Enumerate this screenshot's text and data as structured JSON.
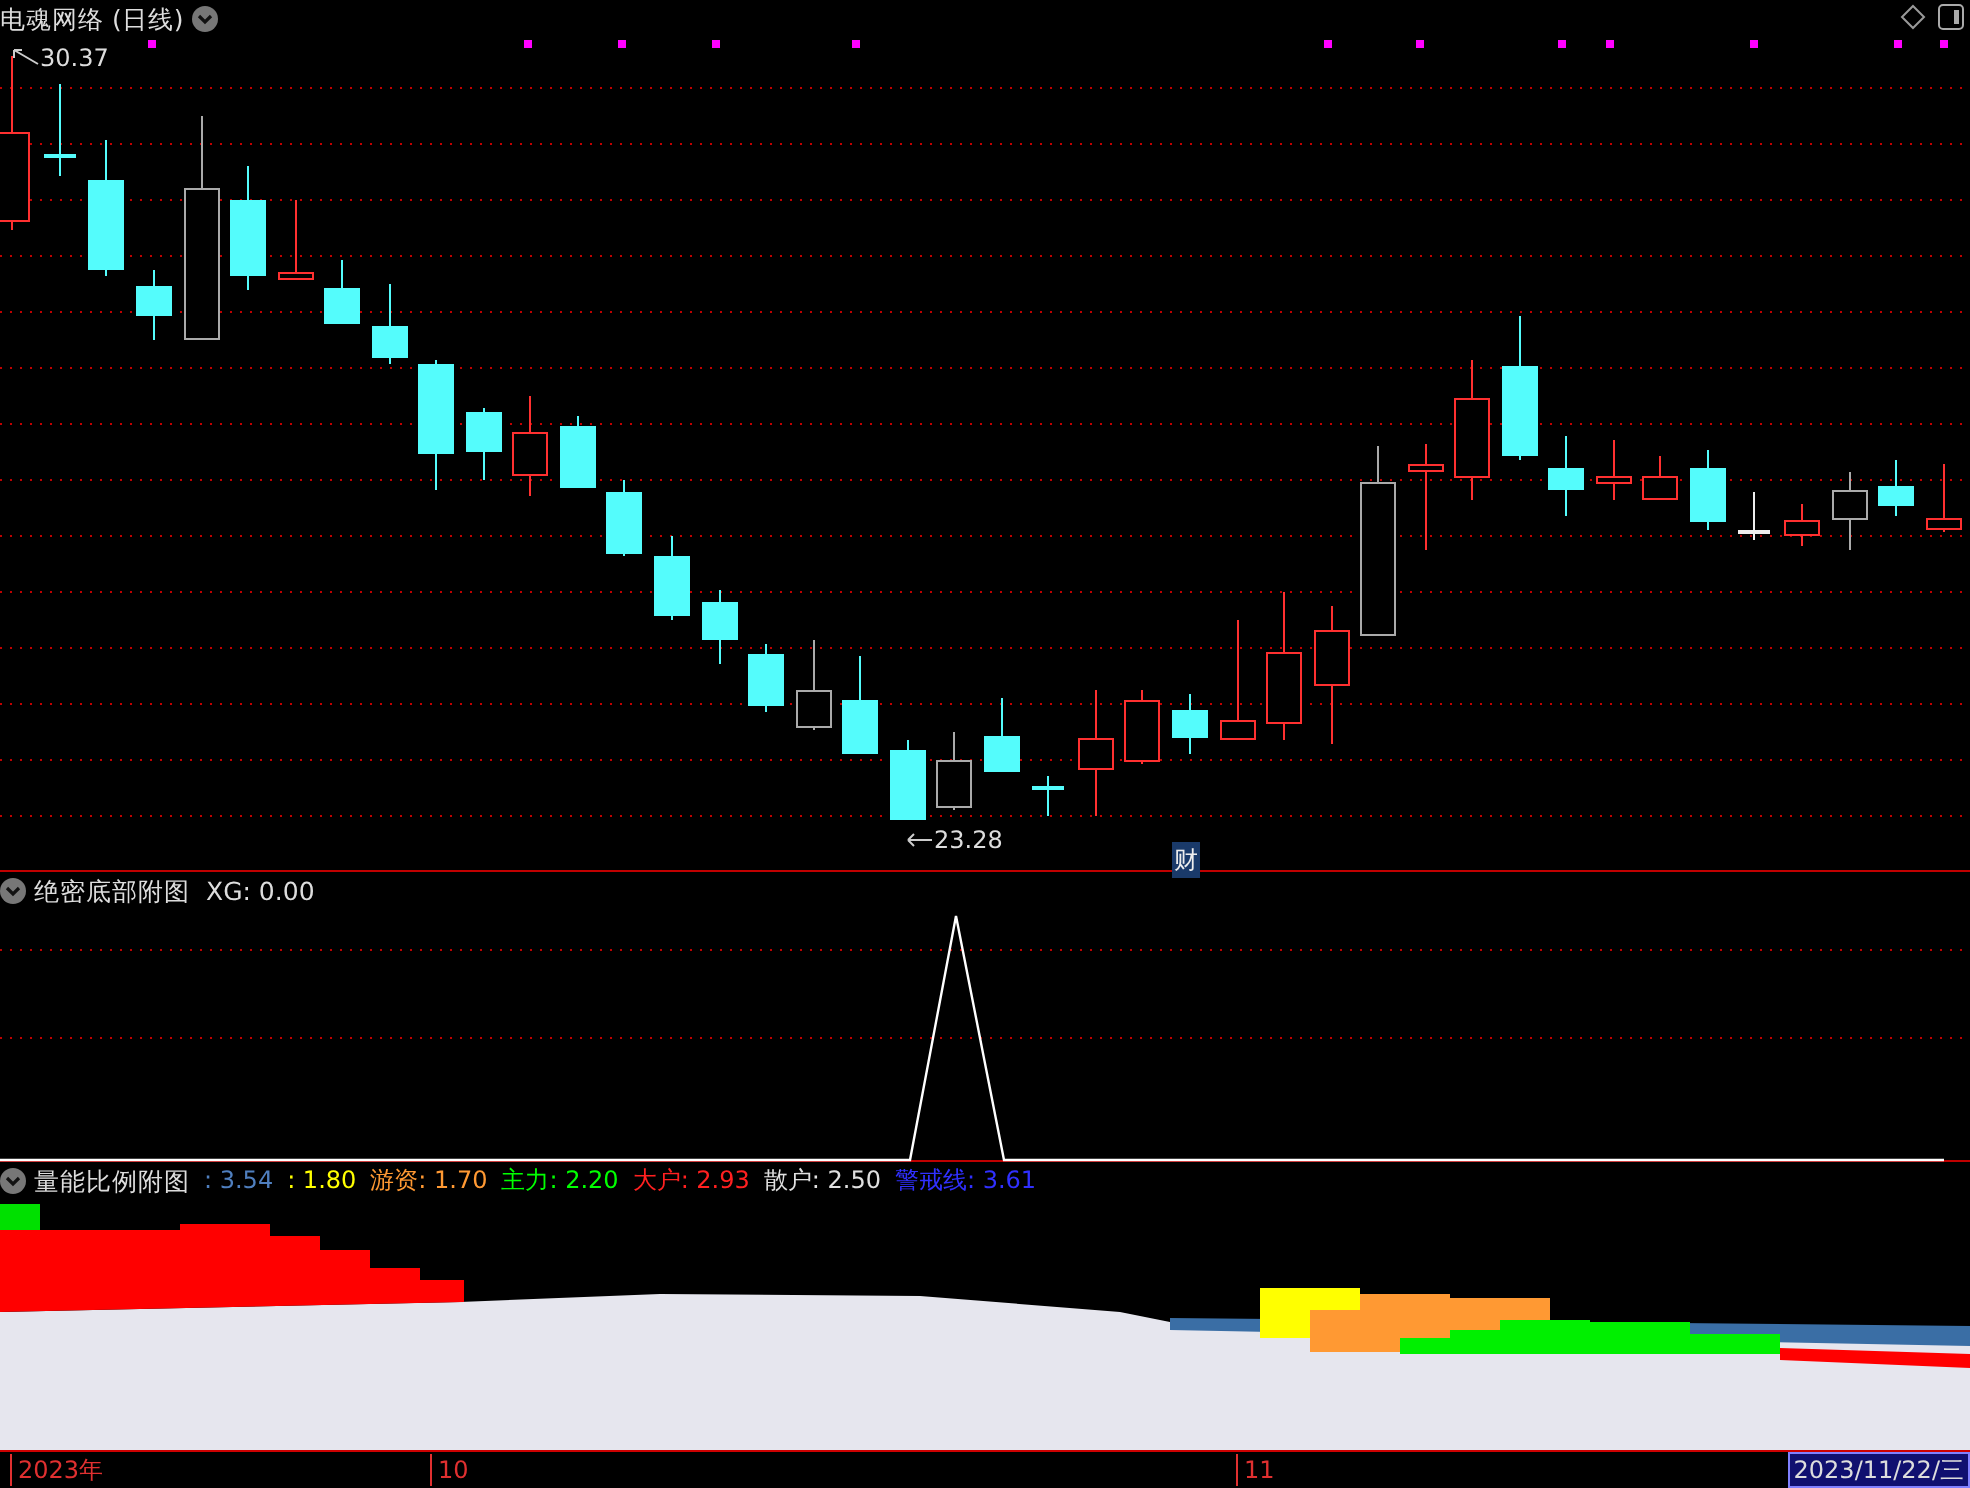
{
  "main_chart": {
    "title": "电魂网络 (日线)",
    "high_label": "30.37",
    "low_label": "23.28",
    "marker": "财"
  },
  "bottom_panel_1": {
    "title": "绝密底部附图",
    "reading": "XG: 0.00"
  },
  "bottom_panel_2": {
    "title": "量能比例附图",
    "legend": [
      {
        "text": ": 3.54",
        "color": "#4f7fbf"
      },
      {
        "text": ": 1.80",
        "color": "#ffff00"
      },
      {
        "text": "游资: 1.70",
        "color": "#ff9933"
      },
      {
        "text": "主力: 2.20",
        "color": "#00ff00"
      },
      {
        "text": "大户: 2.93",
        "color": "#ff2020"
      },
      {
        "text": "散户: 2.50",
        "color": "#e0e0e0"
      },
      {
        "text": "警戒线: 3.61",
        "color": "#3030ff"
      }
    ]
  },
  "time_axis": {
    "labels": [
      "2023年",
      "10",
      "11"
    ],
    "current_date": "2023/11/22/三"
  }
}
